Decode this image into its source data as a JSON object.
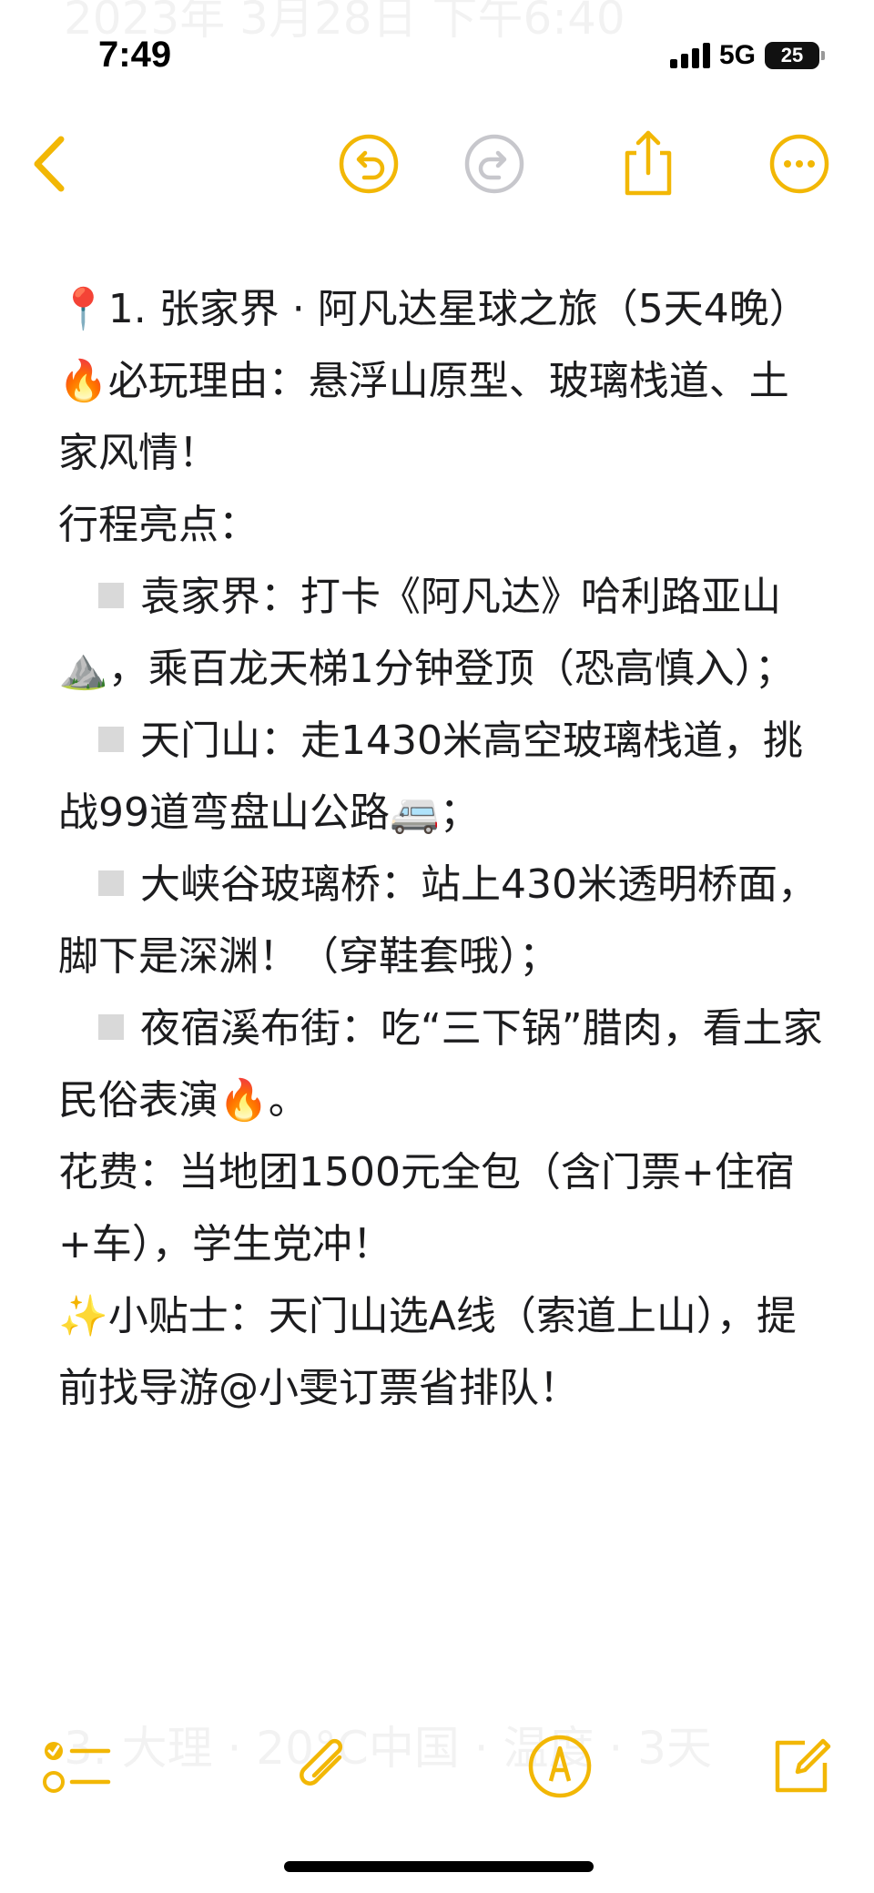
{
  "status_bar": {
    "time": "7:49",
    "network": "5G",
    "battery": "25"
  },
  "ghost": {
    "top_text": "2023年 3月28日 下午6:40",
    "bottom_text": "3. 大理 · 20°C中国 · 温度 · 3天"
  },
  "toolbar": {
    "icons": [
      "back-chevron-icon",
      "undo-icon",
      "redo-icon",
      "share-icon",
      "more-icon"
    ]
  },
  "note": {
    "title": "1. 张家界 · 阿凡达星球之旅（5天4晚）",
    "reason": "必玩理由：悬浮山原型、玻璃栈道、土家风情！",
    "highlights_label": "行程亮点：",
    "items": [
      "袁家界：打卡《阿凡达》哈利路亚山",
      "，乘百龙天梯1分钟登顶（恐高慎入）；",
      "天门山：走1430米高空玻璃栈道，挑战99道弯盘山公路",
      "；",
      "大峡谷玻璃桥：站上430米透明桥面，脚下是深渊！（穿鞋套哦）；",
      "夜宿溪布街：吃“三下锅”腊肉，看土家民俗表演",
      "。"
    ],
    "cost": "花费：当地团1500元全包（含门票+住宿+车），学生党冲！",
    "tip": "小贴士：天门山选A线（索道上山），提前找导游@小雯订票省排队！"
  },
  "bottom_bar": {
    "icons": [
      "checklist-icon",
      "attachment-icon",
      "markup-icon",
      "compose-icon"
    ]
  },
  "colors": {
    "accent": "#F2B705",
    "text": "#1c1c1e"
  }
}
